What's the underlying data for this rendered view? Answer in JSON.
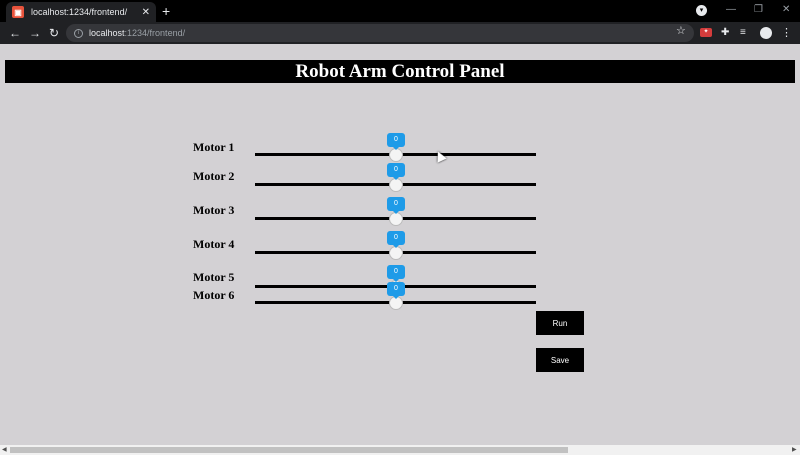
{
  "browser": {
    "tab_title": "localhost:1234/frontend/",
    "url_host": "localhost",
    "url_path": ":1234/frontend/"
  },
  "page": {
    "title": "Robot Arm Control Panel"
  },
  "motors": [
    {
      "label": "Motor 1",
      "value": "0"
    },
    {
      "label": "Motor 2",
      "value": "0"
    },
    {
      "label": "Motor 3",
      "value": "0"
    },
    {
      "label": "Motor 4",
      "value": "0"
    },
    {
      "label": "Motor 5",
      "value": "0"
    },
    {
      "label": "Motor 6",
      "value": "0"
    }
  ],
  "buttons": {
    "run": "Run",
    "save": "Save"
  },
  "colors": {
    "background": "#d3d1d4",
    "accent": "#1e9be8",
    "header": "#000000"
  }
}
